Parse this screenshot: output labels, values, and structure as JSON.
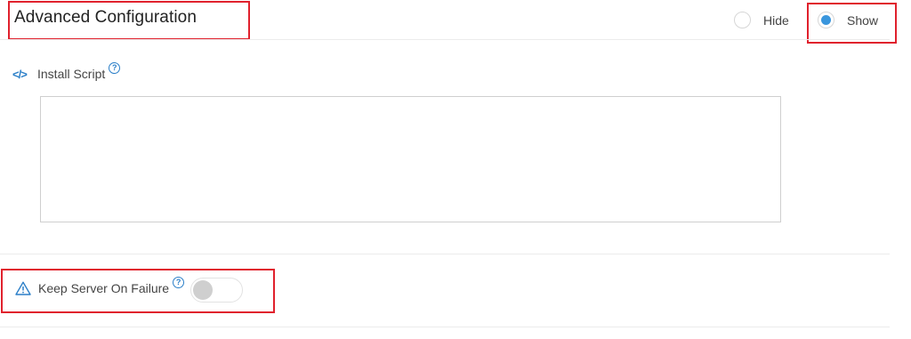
{
  "header": {
    "title": "Advanced Configuration"
  },
  "visibility": {
    "options": [
      {
        "label": "Hide",
        "selected": false
      },
      {
        "label": "Show",
        "selected": true
      }
    ],
    "selected_color": "#3a96dd"
  },
  "install_script": {
    "label": "Install Script",
    "icon": "code-icon",
    "help": "?",
    "value": ""
  },
  "keep_server": {
    "label": "Keep Server On Failure",
    "icon": "warning-icon",
    "help": "?",
    "enabled": false
  },
  "highlight_color": "#e0212d"
}
